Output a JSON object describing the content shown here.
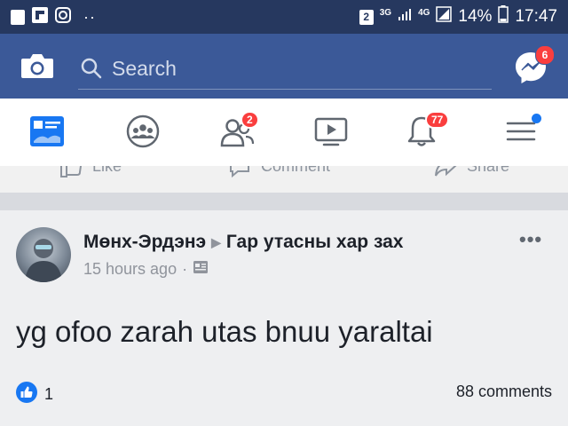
{
  "status_bar": {
    "sim_badge": "2",
    "net1": "3G",
    "net2": "4G",
    "battery": "14%",
    "time": "17:47"
  },
  "header": {
    "search_placeholder": "Search",
    "messenger_badge": "6"
  },
  "tabs": [
    {
      "name": "news-feed",
      "badge": ""
    },
    {
      "name": "groups",
      "badge": ""
    },
    {
      "name": "friend-requests",
      "badge": "2"
    },
    {
      "name": "watch",
      "badge": ""
    },
    {
      "name": "notifications",
      "badge": "77"
    },
    {
      "name": "menu",
      "badge": ""
    }
  ],
  "prev_post_actions": [
    "Like",
    "Comment",
    "Share"
  ],
  "post": {
    "author": "Мөнх-Эрдэнэ",
    "group": "Гар утасны хар зах",
    "time": "15 hours ago",
    "text": "yg ofoo zarah utas bnuu yaraltai",
    "likes": "1",
    "comments": "88 comments"
  },
  "colors": {
    "facebook_blue": "#3b5998",
    "status_bar": "#26385f",
    "badge_red": "#fa3e3e",
    "active_tab": "#1877f2"
  }
}
